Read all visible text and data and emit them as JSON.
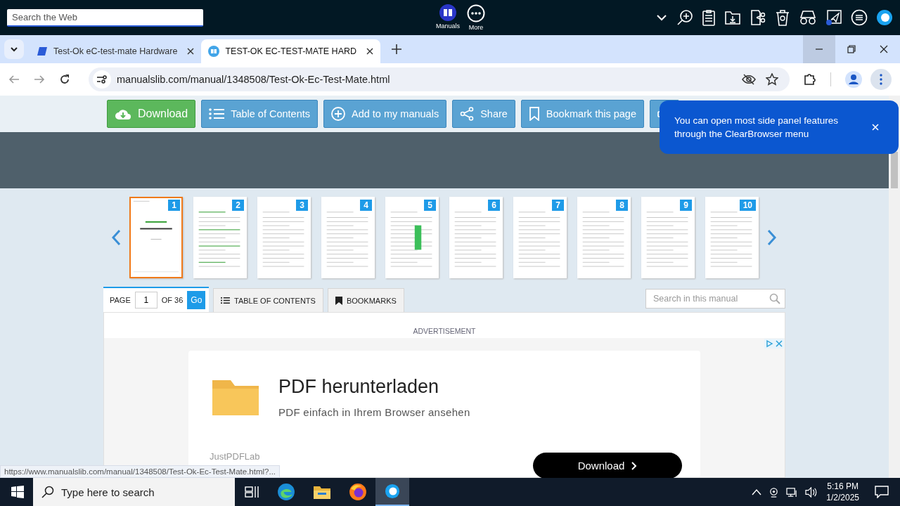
{
  "top_bar": {
    "search": {
      "placeholder": "Search the Web"
    },
    "apps": [
      {
        "label": "Manuals",
        "kind": "manuals"
      },
      {
        "label": "More",
        "kind": "more"
      }
    ]
  },
  "tabs": [
    {
      "title": "Test-Ok eC-test-mate Hardware",
      "selected": false
    },
    {
      "title": "TEST-OK EC-TEST-MATE HARD",
      "selected": true
    }
  ],
  "address_bar": {
    "url": "manualslib.com/manual/1348508/Test-Ok-Ec-Test-Mate.html"
  },
  "toolbar": {
    "buttons": [
      {
        "label": "Download",
        "kind": "download"
      },
      {
        "label": "Table of Contents",
        "kind": "list"
      },
      {
        "label": "Add to my manuals",
        "kind": "add"
      },
      {
        "label": "Share",
        "kind": "share"
      },
      {
        "label": "Bookmark this page",
        "kind": "bookmark"
      }
    ]
  },
  "tooltip": {
    "text": "You can open most side panel features through the ClearBrowser menu"
  },
  "thumbnails": [
    {
      "number": "1",
      "selected": true
    },
    {
      "number": "2",
      "selected": false
    },
    {
      "number": "3",
      "selected": false
    },
    {
      "number": "4",
      "selected": false
    },
    {
      "number": "5",
      "selected": false
    },
    {
      "number": "6",
      "selected": false
    },
    {
      "number": "7",
      "selected": false
    },
    {
      "number": "8",
      "selected": false
    },
    {
      "number": "9",
      "selected": false
    },
    {
      "number": "10",
      "selected": false
    }
  ],
  "viewer": {
    "page_label": "PAGE",
    "page": "1",
    "of": "OF 36",
    "go": "Go",
    "tabs": [
      {
        "label": "TABLE OF CONTENTS",
        "kind": "list"
      },
      {
        "label": "BOOKMARKS",
        "kind": "bookmark"
      }
    ],
    "search": {
      "placeholder": "Search in this manual"
    }
  },
  "ad": {
    "label": "ADVERTISEMENT",
    "title": "PDF herunterladen",
    "subtitle": "PDF einfach in Ihrem Browser ansehen",
    "advertiser": "JustPDFLab",
    "button": "Download"
  },
  "status_url": "https://www.manualslib.com/manual/1348508/Test-Ok-Ec-Test-Mate.html?...",
  "taskbar": {
    "search": {
      "placeholder": "Type here to search"
    },
    "time": "5:16 PM",
    "date": "1/2/2025"
  }
}
